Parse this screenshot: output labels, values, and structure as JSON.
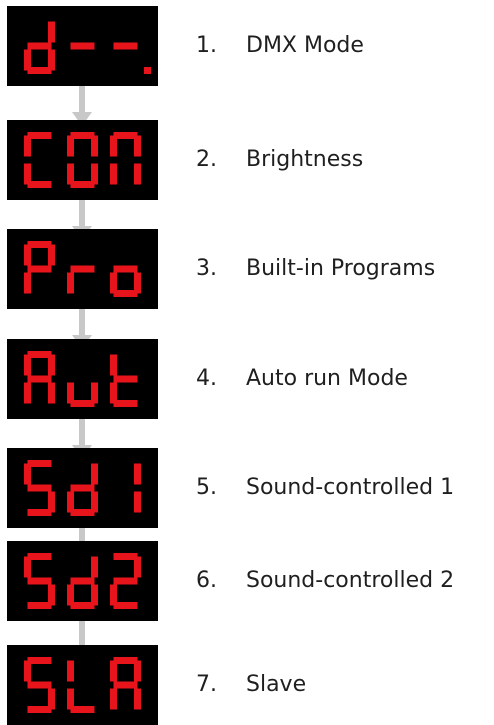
{
  "colors": {
    "segment_on": "#e8141b",
    "display_bg": "#000000",
    "arrow": "#c8c8c8",
    "text": "#1f1f1f"
  },
  "menu": [
    {
      "display": "d--.",
      "number": "1.",
      "label": "DMX Mode"
    },
    {
      "display": "CON",
      "number": "2.",
      "label": "Brightness"
    },
    {
      "display": "Pro",
      "number": "3.",
      "label": "Built-in Programs"
    },
    {
      "display": "Aut",
      "number": "4.",
      "label": "Auto run Mode"
    },
    {
      "display": "Sd1",
      "number": "5.",
      "label": "Sound-controlled 1"
    },
    {
      "display": "Sd2",
      "number": "6.",
      "label": "Sound-controlled 2"
    },
    {
      "display": "SLA",
      "number": "7.",
      "label": "Slave"
    }
  ]
}
